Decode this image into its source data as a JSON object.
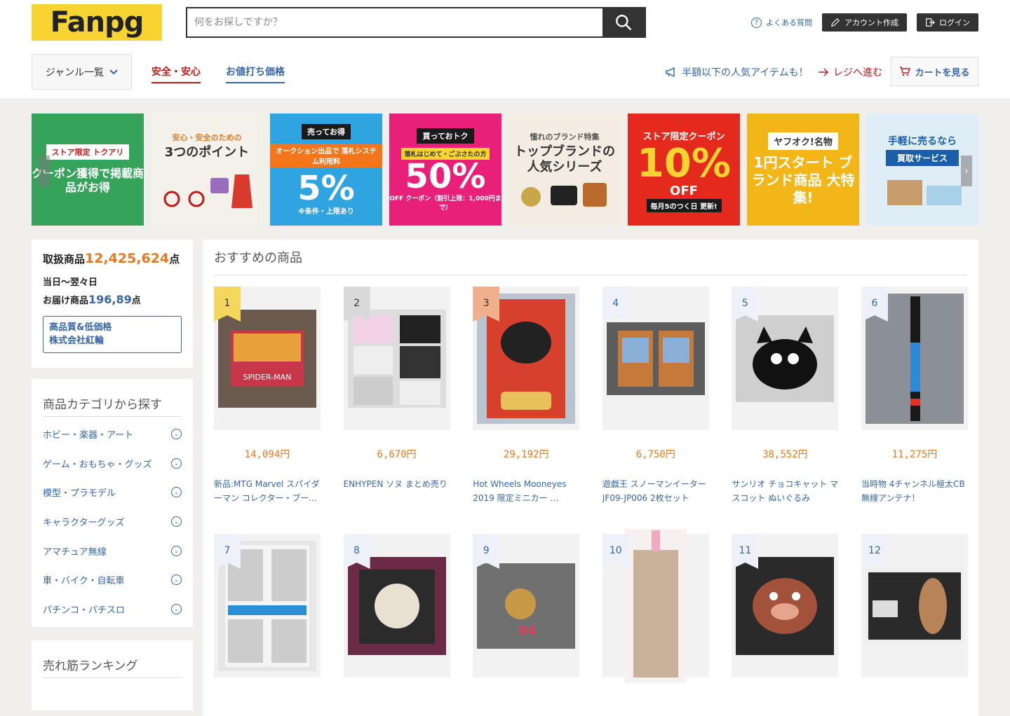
{
  "logo": "Fanpg",
  "search": {
    "placeholder": "何をお探しですか？"
  },
  "top_links": {
    "faq": "よくある質問",
    "create_account": "アカウント作成",
    "login": "ログイン"
  },
  "nav": {
    "genre": "ジャンル一覧",
    "safe": "安全・安心",
    "bargain": "お値打ち価格"
  },
  "promo": "半額以下の人気アイテムも！",
  "register": "レジへ進む",
  "cart": "カートを見る",
  "banners": [
    {
      "top": "ストア限定 トクアリ",
      "main": "クーポン獲得で掲載商品がお得"
    },
    {
      "top": "安心・安全のための",
      "main": "3つのポイント"
    },
    {
      "top": "売ってお得",
      "main": "オークション出品で 落札システム利用料",
      "big": "5%",
      "small": "※条件・上限あり"
    },
    {
      "top": "買っておトク",
      "main": "落札はじめて・ごぶさたの方",
      "big": "50%",
      "small": "OFF クーポン（割引上限：1,000円まで）"
    },
    {
      "top": "憧れのブランド特集",
      "main": "トップブランドの 人気シリーズ"
    },
    {
      "top": "ストア限定クーポン",
      "big": "10%",
      "main": "OFF",
      "small": "毎月5のつく日 更新!"
    },
    {
      "top": "ヤフオク!名物",
      "main": "1円スタート ブランド商品 大特集!"
    },
    {
      "top": "手軽に売るなら",
      "main": "買取サービス"
    }
  ],
  "stats": {
    "total_label": "取扱商品",
    "total_value": "12,425,624",
    "total_unit": "点",
    "delivery_label_1": "当日〜翌々日",
    "delivery_label_2": "お届け商品",
    "delivery_value": "196,89",
    "delivery_unit": "点",
    "shop_line1": "高品質&低価格",
    "shop_line2": "株式会社紅輪"
  },
  "categories": {
    "title": "商品カテゴリから探す",
    "items": [
      "ホビー・楽器・アート",
      "ゲーム・おもちゃ・グッズ",
      "模型・プラモデル",
      "キャラクターグッズ",
      "アマチュア無線",
      "車・バイク・自転車",
      "パチンコ・パチスロ"
    ]
  },
  "ranking": {
    "title": "売れ筋ランキング"
  },
  "recommend": {
    "title": "おすすめの商品",
    "items": [
      {
        "rank": "1",
        "price": "14,094円",
        "name": "新品:MTG Marvel スパイダーマン コレクター・ブースター"
      },
      {
        "rank": "2",
        "price": "6,670円",
        "name": "ENHYPEN ソヌ まとめ売り"
      },
      {
        "rank": "3",
        "price": "29,192円",
        "name": "Hot Wheels Mooneyes 2019 限定ミニカー …"
      },
      {
        "rank": "4",
        "price": "6,750円",
        "name": "遊戯王 スノーマンイーター JF09-JP006 2枚セット"
      },
      {
        "rank": "5",
        "price": "38,552円",
        "name": "サンリオ チョコキャット マスコット ぬいぐるみ"
      },
      {
        "rank": "6",
        "price": "11,275円",
        "name": "当時物 4チャンネル極太CB無線アンテナ！"
      },
      {
        "rank": "7"
      },
      {
        "rank": "8"
      },
      {
        "rank": "9"
      },
      {
        "rank": "10"
      },
      {
        "rank": "11"
      },
      {
        "rank": "12"
      }
    ]
  },
  "colors": {
    "brand_yellow": "#f7d431",
    "link_blue": "#3466a8",
    "price_orange": "#e8791e",
    "accent_red": "#c01818"
  }
}
